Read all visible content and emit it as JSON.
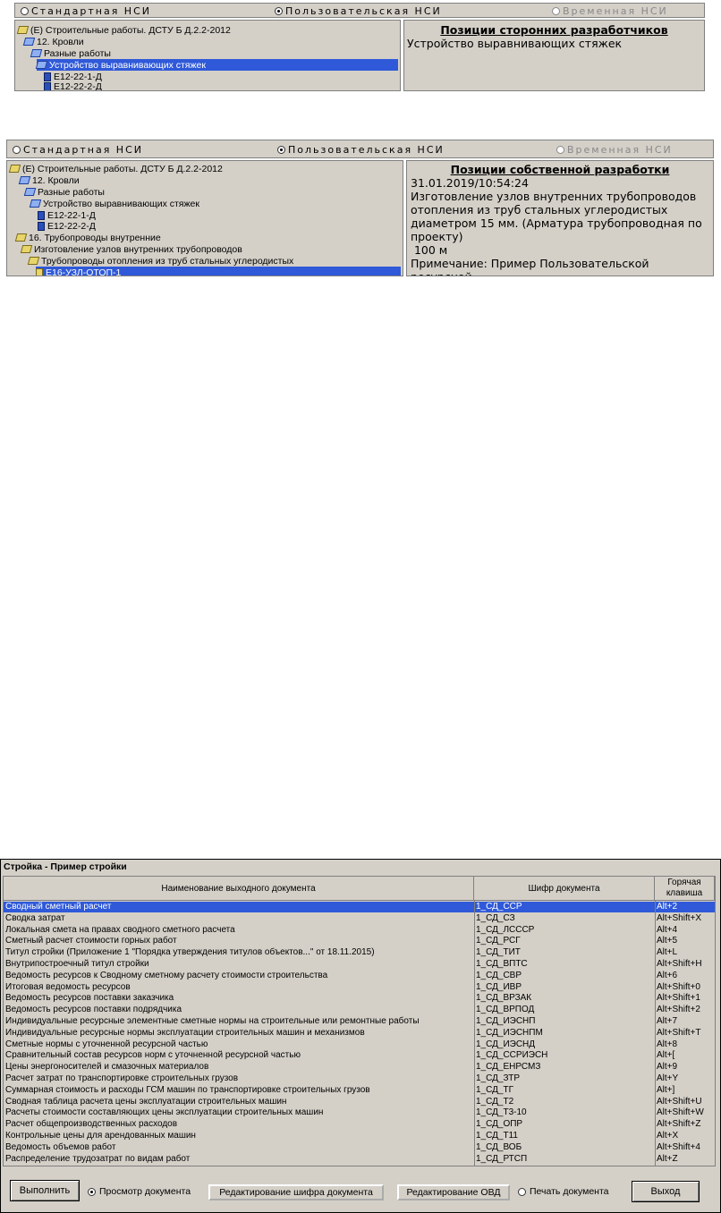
{
  "panel1": {
    "radios": [
      {
        "label": "Стандартная НСИ",
        "selected": false,
        "enabled": true
      },
      {
        "label": "Пользовательская НСИ",
        "selected": true,
        "enabled": true
      },
      {
        "label": "Временная НСИ",
        "selected": false,
        "enabled": false
      }
    ],
    "tree": [
      {
        "label": "(Е) Строительные работы. ДСТУ Б Д.2.2-2012",
        "icon": "folder-open-icon"
      },
      {
        "label": "12. Кровли",
        "icon": "folder-open-blue-icon"
      },
      {
        "label": "Разные работы",
        "icon": "folder-open-blue-icon"
      },
      {
        "label": "Устройство выравнивающих стяжек",
        "icon": "folder-open-blue-icon",
        "selected": true
      },
      {
        "label": "Е12-22-1-Д",
        "icon": "document-icon"
      },
      {
        "label": "Е12-22-2-Д",
        "icon": "document-icon"
      }
    ],
    "detail": {
      "title": "Позиции сторонних разработчиков",
      "text": "Устройство выравнивающих стяжек"
    }
  },
  "panel2": {
    "radios": [
      {
        "label": "Стандартная НСИ",
        "selected": false,
        "enabled": true
      },
      {
        "label": "Пользовательская НСИ",
        "selected": true,
        "enabled": true
      },
      {
        "label": "Временная НСИ",
        "selected": false,
        "enabled": false
      }
    ],
    "tree": [
      {
        "label": "(Е) Строительные работы. ДСТУ Б Д.2.2-2012",
        "icon": "folder-open-icon"
      },
      {
        "label": "12. Кровли",
        "icon": "folder-open-blue-icon"
      },
      {
        "label": "Разные работы",
        "icon": "folder-open-blue-icon"
      },
      {
        "label": "Устройство выравнивающих стяжек",
        "icon": "folder-open-blue-icon"
      },
      {
        "label": "Е12-22-1-Д",
        "icon": "document-icon"
      },
      {
        "label": "Е12-22-2-Д",
        "icon": "document-icon"
      },
      {
        "label": "16. Трубопроводы внутренние",
        "icon": "folder-open-icon"
      },
      {
        "label": "Изготовление узлов внутренних трубопроводов",
        "icon": "folder-open-icon"
      },
      {
        "label": "Трубопроводы отопления из труб стальных углеродистых",
        "icon": "folder-open-icon"
      },
      {
        "label": "Е16-УЗЛ-ОТОП-1",
        "icon": "document-yellow-icon",
        "selected": true
      }
    ],
    "detail": {
      "title": "Позиции собственной разработки",
      "lines": [
        "31.01.2019/10:54:24",
        "Изготовление узлов внутренних трубопроводов",
        "отопления из труб стальных углеродистых",
        "диаметром 15 мм. (Арматура трубопроводная по",
        "проекту)",
        " 100 м",
        "Примечание: Пример Пользовательской ресурсной"
      ]
    }
  },
  "report": {
    "title": "Стройка - Пример стройки",
    "columns": [
      "Наименование выходного документа",
      "Шифр документа",
      "Горячая клавиша"
    ],
    "rows": [
      [
        "Сводный сметный расчет",
        "1_СД_ССР",
        "Alt+2"
      ],
      [
        "Сводка затрат",
        "1_СД_СЗ",
        "Alt+Shift+X"
      ],
      [
        "Локальная смета на правах сводного сметного расчета",
        "1_СД_ЛСССР",
        "Alt+4"
      ],
      [
        "Сметный расчет стоимости горных работ",
        "1_СД_РСГ",
        "Alt+5"
      ],
      [
        "Титул стройки (Приложение 1 \"Порядка утверждения титулов объектов...\" от 18.11.2015)",
        "1_СД_ТИТ",
        "Alt+L"
      ],
      [
        "Внутрипостроечный титул стройки",
        "1_СД_ВПТС",
        "Alt+Shift+H"
      ],
      [
        "Ведомость ресурсов к Сводному сметному расчету стоимости строительства",
        "1_СД_СВР",
        "Alt+6"
      ],
      [
        "Итоговая ведомость ресурсов",
        "1_СД_ИВР",
        "Alt+Shift+0"
      ],
      [
        "Ведомость ресурсов поставки заказчика",
        "1_СД_ВРЗАК",
        "Alt+Shift+1"
      ],
      [
        "Ведомость ресурсов поставки подрядчика",
        "1_СД_ВРПОД",
        "Alt+Shift+2"
      ],
      [
        "Индивидуальные ресурсные элементные сметные нормы на строительные или ремонтные работы",
        "1_СД_ИЭСНП",
        "Alt+7"
      ],
      [
        "Индивидуальные ресурсные нормы эксплуатации строительных машин и механизмов",
        "1_СД_ИЭСНПМ",
        "Alt+Shift+T"
      ],
      [
        "Сметные нормы с уточненной ресурсной частью",
        "1_СД_ИЭСНД",
        "Alt+8"
      ],
      [
        "Сравнительный состав ресурсов норм  с уточненной ресурсной частью",
        "1_СД_ССРИЭСН",
        "Alt+["
      ],
      [
        "Цены энергоносителей и смазочных материалов",
        "1_СД_ЕНРСМЗ",
        "Alt+9"
      ],
      [
        "Расчет затрат по транспортировке строительных грузов",
        "1_СД_ЗТР",
        "Alt+Y"
      ],
      [
        "Суммарная стоимость и расходы ГСМ машин по транспортировке строительных грузов",
        "1_СД_ТГ",
        "Alt+]"
      ],
      [
        "Сводная таблица расчета цены эксплуатации строительных машин",
        "1_СД_Т2",
        "Alt+Shift+U"
      ],
      [
        "Расчеты стоимости составляющих цены эксплуатации строительных машин",
        "1_СД_Т3-10",
        "Alt+Shift+W"
      ],
      [
        "Расчет общепроизводственных расходов",
        "1_СД_ОПР",
        "Alt+Shift+Z"
      ],
      [
        "Контрольные цены для арендованных машин",
        "1_СД_Т11",
        "Alt+X"
      ],
      [
        "Ведомость объемов работ",
        "1_СД_ВОБ",
        "Alt+Shift+4"
      ],
      [
        "Распределение трудозатрат по видам работ",
        "1_СД_РТСП",
        "Alt+Z"
      ]
    ],
    "selected_row": 0,
    "buttons": {
      "run": "Выполнить",
      "view": "Просмотр документа",
      "edit_code": "Редактирование  шифра документа",
      "edit_ovd": "Редактирование ОВД",
      "print": "Печать документа",
      "exit": "Выход"
    }
  }
}
